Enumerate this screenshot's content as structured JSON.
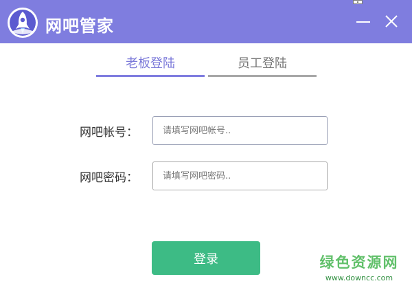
{
  "window": {
    "title": "网吧管家"
  },
  "tabs": [
    {
      "label": "老板登陆",
      "active": true
    },
    {
      "label": "员工登陆",
      "active": false
    }
  ],
  "form": {
    "account_label": "网吧帐号：",
    "account_placeholder": "请填写网吧帐号..",
    "account_value": "",
    "password_label": "网吧密码：",
    "password_placeholder": "请填写网吧密码..",
    "password_value": ""
  },
  "login_button": {
    "label": "登录"
  },
  "watermark": {
    "line1": "绿色资源网",
    "line2": "www.downcc.com"
  },
  "colors": {
    "titlebar": "#7f7ddf",
    "active_tab": "#7f7ddf",
    "inactive_tab": "#a7a7a7",
    "login_button": "#3dbb85",
    "watermark": "#61c06a"
  }
}
